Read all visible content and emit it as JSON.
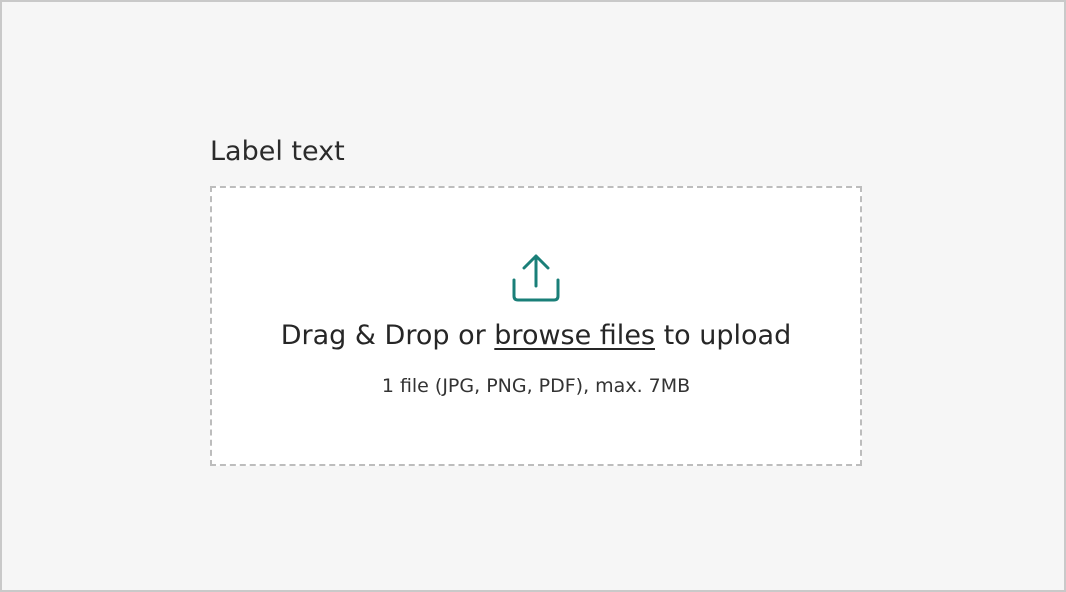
{
  "field": {
    "label": "Label text"
  },
  "dropzone": {
    "icon": "upload-icon",
    "accent_color": "#1a7f78",
    "text_before": "Drag & Drop or ",
    "browse_link": "browse files",
    "text_after": " to upload",
    "hint": "1 file (JPG, PNG, PDF), max. 7MB"
  }
}
